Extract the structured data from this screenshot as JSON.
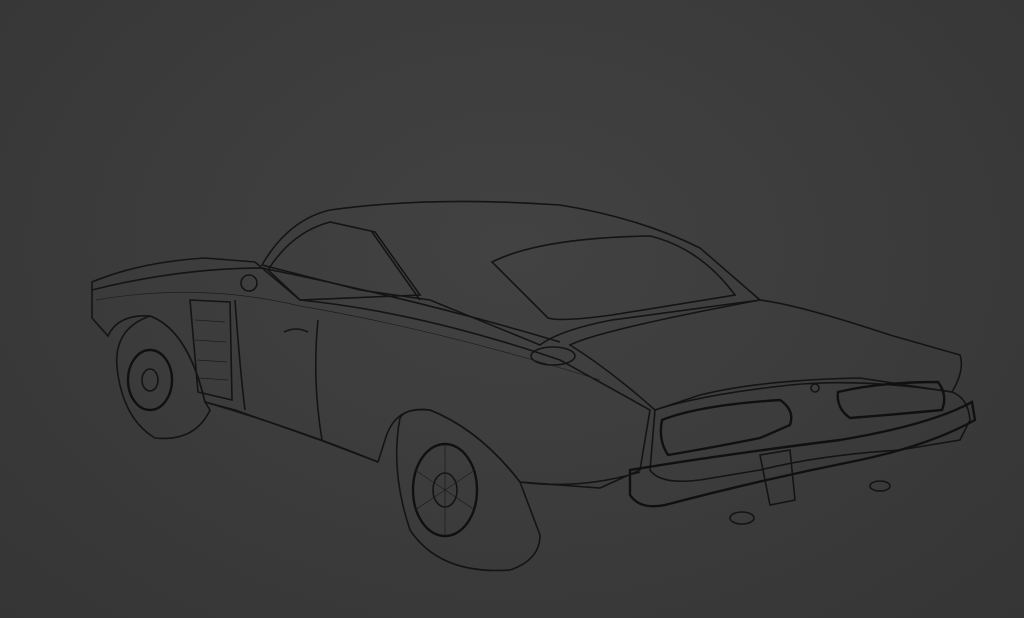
{
  "viewport": {
    "background_color": "#3a3a3a",
    "wire_color": "#1c1c1c"
  },
  "model": {
    "subject": "car",
    "display_mode": "wireframe"
  }
}
